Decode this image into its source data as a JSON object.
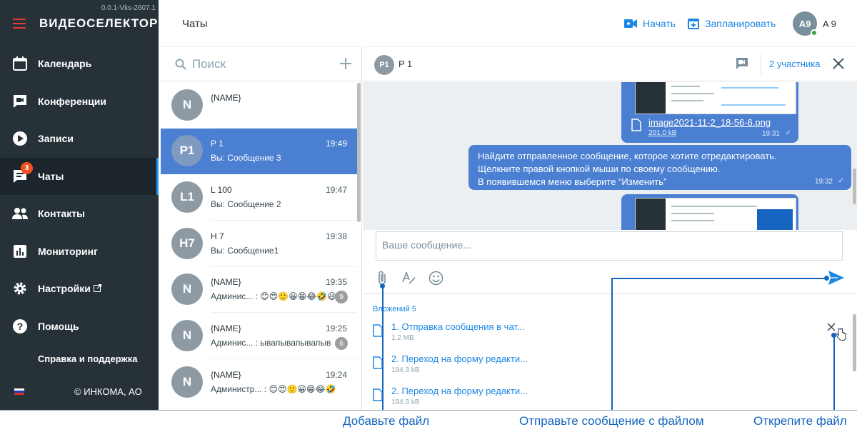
{
  "app": {
    "version": "0.0.1-Vks-2607.1",
    "logo": "ВИДЕОСЕЛЕКТОР"
  },
  "sidebar": {
    "items": [
      {
        "label": "Календарь",
        "icon": "calendar-icon"
      },
      {
        "label": "Конференции",
        "icon": "conference-icon"
      },
      {
        "label": "Записи",
        "icon": "play-icon"
      },
      {
        "label": "Чаты",
        "icon": "chat-icon",
        "badge": "3",
        "active": true
      },
      {
        "label": "Контакты",
        "icon": "contacts-icon"
      },
      {
        "label": "Мониторинг",
        "icon": "chart-icon"
      },
      {
        "label": "Настройки",
        "icon": "gear-icon"
      },
      {
        "label": "Помощь",
        "icon": "help-icon"
      }
    ],
    "support": "Справка и поддержка",
    "copyright": "© ИНКОМА, АО"
  },
  "header": {
    "title": "Чаты",
    "start_label": "Начать",
    "schedule_label": "Запланировать",
    "user_initials": "A9",
    "user_name": "A 9"
  },
  "chat_list": {
    "search_placeholder": "Поиск",
    "chats": [
      {
        "initials": "N",
        "name": "{NAME}",
        "time": "",
        "preview": "",
        "count": ""
      },
      {
        "initials": "P1",
        "name": "P 1",
        "time": "19:49",
        "preview": "Вы: Сообщение 3",
        "count": "",
        "active": true
      },
      {
        "initials": "L1",
        "name": "L 100",
        "time": "19:47",
        "preview": "Вы: Сообщение 2",
        "count": ""
      },
      {
        "initials": "H7",
        "name": "H 7",
        "time": "19:38",
        "preview": "Вы: Сообщение1",
        "count": ""
      },
      {
        "initials": "N",
        "name": "{NAME}",
        "time": "19:35",
        "preview": "Админис... : 😊😍🙂😀😁😂🤣😃😄😅😆😉",
        "count": "9"
      },
      {
        "initials": "N",
        "name": "{NAME}",
        "time": "19:25",
        "preview": "Админис... : ывапывапывапыв",
        "count": "6"
      },
      {
        "initials": "N",
        "name": "{NAME}",
        "time": "19:24",
        "preview": "Администр... : 😊😍🙂😀😁😂🤣😃😄😅😆😉",
        "count": ""
      }
    ]
  },
  "conversation": {
    "initials": "P1",
    "name": "P 1",
    "members": "2 участника",
    "image_message": {
      "file_name": "image2021-11-2_18-56-6.png",
      "file_size": "201.0 kB",
      "time": "19:31"
    },
    "text_message": {
      "line1": "Найдите отправленное сообщение, которое хотите отредактировать.",
      "line2": "Щелкните правой кнопкой мыши по своему сообщению.",
      "line3": "В появившемся меню выберите “Изменить”",
      "time": "19:32"
    },
    "compose_placeholder": "Ваше сообщение...",
    "attachments_title": "Вложений 5",
    "attachments": [
      {
        "name": "1. Отправка сообщения в чат...",
        "size": "1.2 MB"
      },
      {
        "name": "2. Переход на форму редакти...",
        "size": "194.3 kB"
      },
      {
        "name": "2. Переход на форму редакти...",
        "size": "194.3 kB"
      }
    ]
  },
  "annotations": {
    "add_file": "Добавьте файл",
    "send_with_file": "Отправьте сообщение с файлом",
    "detach_file": "Открепите файл"
  },
  "colors": {
    "sidebar": "#263238",
    "accent": "#1e88e5",
    "bubble": "#4a7fd1",
    "badge": "#f4511e"
  }
}
